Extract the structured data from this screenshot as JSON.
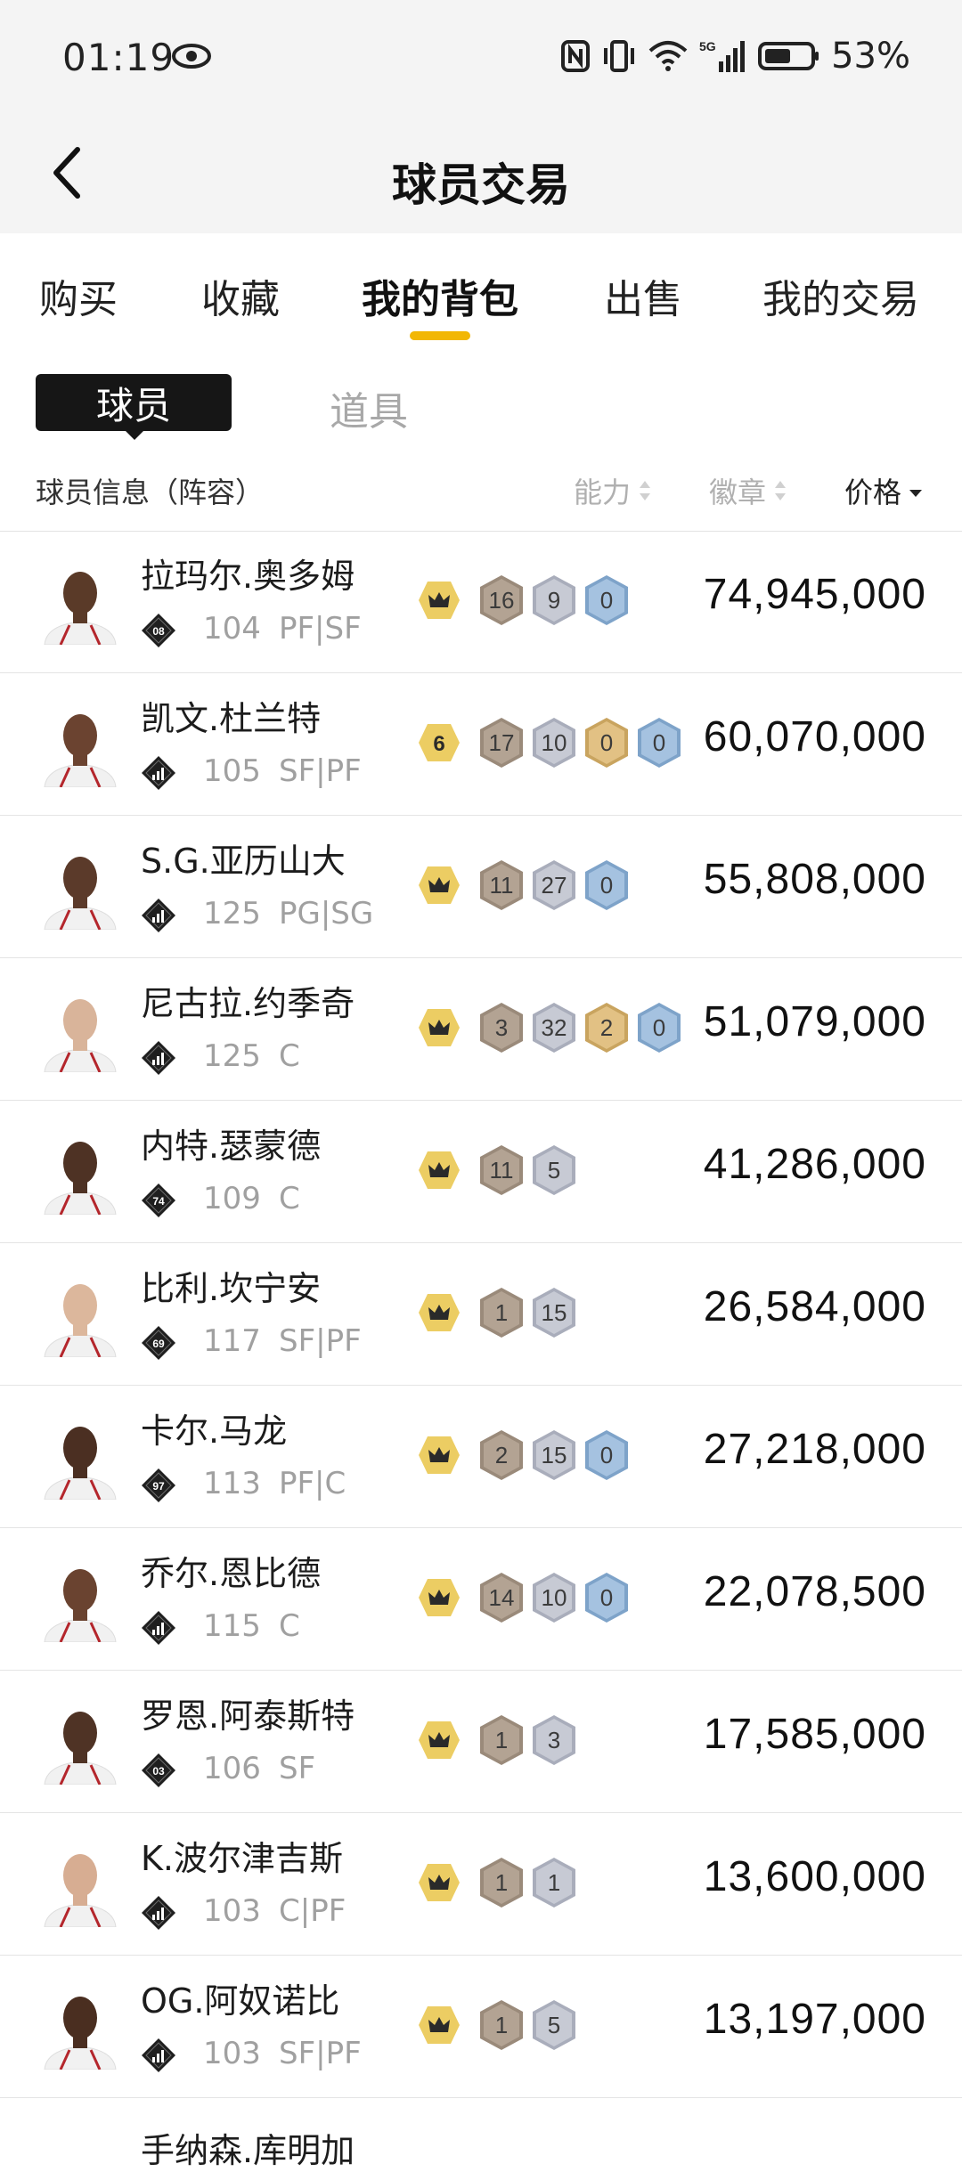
{
  "status_bar": {
    "time": "01:19",
    "battery": "53%",
    "network": "5G"
  },
  "header": {
    "title": "球员交易"
  },
  "tabs": [
    {
      "label": "购买",
      "active": false
    },
    {
      "label": "收藏",
      "active": false
    },
    {
      "label": "我的背包",
      "active": true
    },
    {
      "label": "出售",
      "active": false
    },
    {
      "label": "我的交易",
      "active": false
    }
  ],
  "subtabs": {
    "active": "球员",
    "other": "道具"
  },
  "list_header": {
    "info": "球员信息（阵容）",
    "ability": "能力",
    "badges": "徽章",
    "price": "价格"
  },
  "colors": {
    "accent": "#f2b705",
    "tier": "#eccd63",
    "bronze": "#a89886",
    "silver": "#b9bcc8",
    "gold": "#d9b36a",
    "platinum": "#8fb3d6"
  },
  "players": [
    {
      "name": "拉玛尔.奥多姆",
      "badge": "08",
      "rating": "104",
      "position": "PF|SF",
      "tier": "crown",
      "badges": [
        {
          "type": "bronze",
          "value": "16"
        },
        {
          "type": "silver",
          "value": "9"
        },
        {
          "type": "platinum",
          "value": "0"
        }
      ],
      "price": "74,945,000",
      "skin": "#5a3a28"
    },
    {
      "name": "凯文.杜兰特",
      "badge": "bars",
      "rating": "105",
      "position": "SF|PF",
      "tier": "6",
      "badges": [
        {
          "type": "bronze",
          "value": "17"
        },
        {
          "type": "silver",
          "value": "10"
        },
        {
          "type": "gold",
          "value": "0"
        },
        {
          "type": "platinum",
          "value": "0"
        }
      ],
      "price": "60,070,000",
      "skin": "#6b4330"
    },
    {
      "name": "S.G.亚历山大",
      "badge": "bars",
      "rating": "125",
      "position": "PG|SG",
      "tier": "crown",
      "badges": [
        {
          "type": "bronze",
          "value": "11"
        },
        {
          "type": "silver",
          "value": "27"
        },
        {
          "type": "platinum",
          "value": "0"
        }
      ],
      "price": "55,808,000",
      "skin": "#5b3a2a"
    },
    {
      "name": "尼古拉.约季奇",
      "badge": "bars",
      "rating": "125",
      "position": "C",
      "tier": "crown",
      "badges": [
        {
          "type": "bronze",
          "value": "3"
        },
        {
          "type": "silver",
          "value": "32"
        },
        {
          "type": "gold",
          "value": "2"
        },
        {
          "type": "platinum",
          "value": "0"
        }
      ],
      "price": "51,079,000",
      "skin": "#d9b49a"
    },
    {
      "name": "内特.瑟蒙德",
      "badge": "74",
      "rating": "109",
      "position": "C",
      "tier": "crown",
      "badges": [
        {
          "type": "bronze",
          "value": "11"
        },
        {
          "type": "silver",
          "value": "5"
        }
      ],
      "price": "41,286,000",
      "skin": "#4e3224"
    },
    {
      "name": "比利.坎宁安",
      "badge": "69",
      "rating": "117",
      "position": "SF|PF",
      "tier": "crown",
      "badges": [
        {
          "type": "bronze",
          "value": "1"
        },
        {
          "type": "silver",
          "value": "15"
        }
      ],
      "price": "26,584,000",
      "skin": "#dcb79c"
    },
    {
      "name": "卡尔.马龙",
      "badge": "97",
      "rating": "113",
      "position": "PF|C",
      "tier": "crown",
      "badges": [
        {
          "type": "bronze",
          "value": "2"
        },
        {
          "type": "silver",
          "value": "15"
        },
        {
          "type": "platinum",
          "value": "0"
        }
      ],
      "price": "27,218,000",
      "skin": "#4b2f22"
    },
    {
      "name": "乔尔.恩比德",
      "badge": "bars",
      "rating": "115",
      "position": "C",
      "tier": "crown",
      "badges": [
        {
          "type": "bronze",
          "value": "14"
        },
        {
          "type": "silver",
          "value": "10"
        },
        {
          "type": "platinum",
          "value": "0"
        }
      ],
      "price": "22,078,500",
      "skin": "#6a4330"
    },
    {
      "name": "罗恩.阿泰斯特",
      "badge": "03",
      "rating": "106",
      "position": "SF",
      "tier": "crown",
      "badges": [
        {
          "type": "bronze",
          "value": "1"
        },
        {
          "type": "silver",
          "value": "3"
        }
      ],
      "price": "17,585,000",
      "skin": "#4f3325"
    },
    {
      "name": "K.波尔津吉斯",
      "badge": "bars",
      "rating": "103",
      "position": "C|PF",
      "tier": "crown",
      "badges": [
        {
          "type": "bronze",
          "value": "1"
        },
        {
          "type": "silver",
          "value": "1"
        }
      ],
      "price": "13,600,000",
      "skin": "#d7ad92"
    },
    {
      "name": "OG.阿奴诺比",
      "badge": "bars",
      "rating": "103",
      "position": "SF|PF",
      "tier": "crown",
      "badges": [
        {
          "type": "bronze",
          "value": "1"
        },
        {
          "type": "silver",
          "value": "5"
        }
      ],
      "price": "13,197,000",
      "skin": "#4a2e20"
    }
  ],
  "partial_row": {
    "name": "手纳森.库明加"
  }
}
